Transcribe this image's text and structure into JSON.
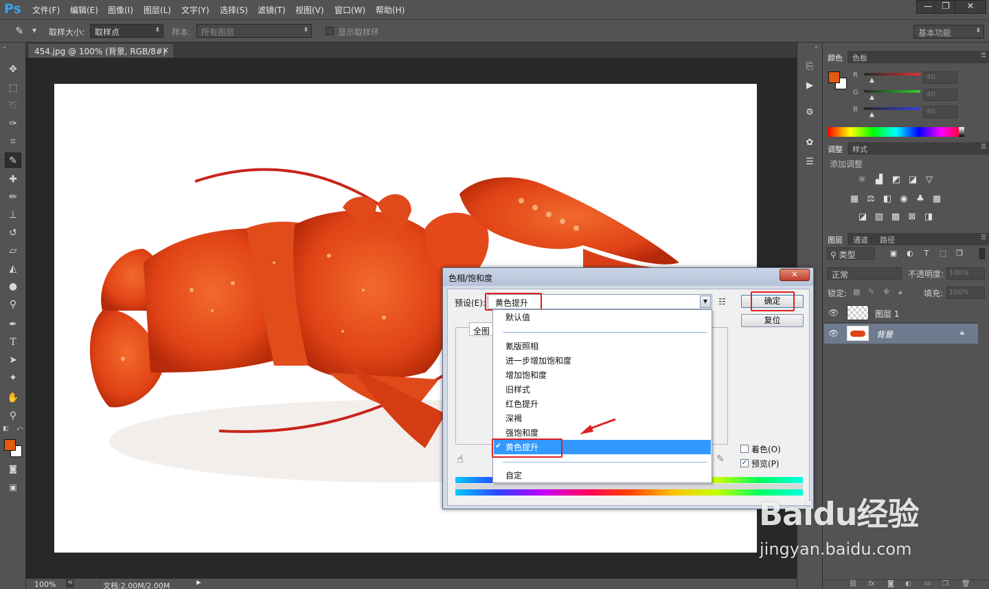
{
  "app": {
    "logo": "Ps"
  },
  "menu": [
    "文件(F)",
    "编辑(E)",
    "图像(I)",
    "图层(L)",
    "文字(Y)",
    "选择(S)",
    "滤镜(T)",
    "视图(V)",
    "窗口(W)",
    "帮助(H)"
  ],
  "window_buttons": [
    "—",
    "❐",
    "✕"
  ],
  "options_bar": {
    "sample_size_label": "取样大小:",
    "sample_size_value": "取样点",
    "sample_label": "样本:",
    "sample_value": "所有图层",
    "show_ring_label": "显示取样环",
    "workspace": "基本功能"
  },
  "document": {
    "tab_title": "454.jpg @ 100% (背景, RGB/8#) *",
    "tab_close": "×"
  },
  "status": {
    "zoom": "100%",
    "doc_size": "文档:2.00M/2.00M"
  },
  "color_panel": {
    "tabs": [
      "颜色",
      "色板"
    ],
    "channels": [
      {
        "label": "R",
        "value": "40"
      },
      {
        "label": "G",
        "value": "40"
      },
      {
        "label": "B",
        "value": "40"
      }
    ],
    "foreground": "#e25a0f",
    "background": "#ffffff"
  },
  "adjust_panel": {
    "tabs": [
      "调整",
      "样式"
    ],
    "add_label": "添加调整"
  },
  "layers_panel": {
    "tabs": [
      "图层",
      "通道",
      "路径"
    ],
    "filter_label": "类型",
    "blend_mode": "正常",
    "opacity_label": "不透明度:",
    "opacity_value": "100%",
    "lock_label": "锁定:",
    "fill_label": "填充:",
    "fill_value": "100%",
    "layers": [
      {
        "name": "图层 1"
      },
      {
        "name": "背景"
      }
    ]
  },
  "dialog": {
    "title": "色相/饱和度",
    "close": "✕",
    "preset_label": "预设(E):",
    "preset_value": "黄色提升",
    "ok": "确定",
    "reset": "复位",
    "channel_tab": "全图",
    "colorize_label": "着色(O)",
    "preview_label": "预览(P)",
    "preview_checked": true,
    "dropdown": {
      "top_item": "默认值",
      "items": [
        "氰版照相",
        "进一步增加饱和度",
        "增加饱和度",
        "旧样式",
        "红色提升",
        "深褐",
        "强饱和度",
        "黄色提升"
      ],
      "selected": "黄色提升",
      "bottom_item": "自定"
    }
  },
  "watermark": {
    "brand": "Baidu经验",
    "url": "jingyan.baidu.com"
  }
}
